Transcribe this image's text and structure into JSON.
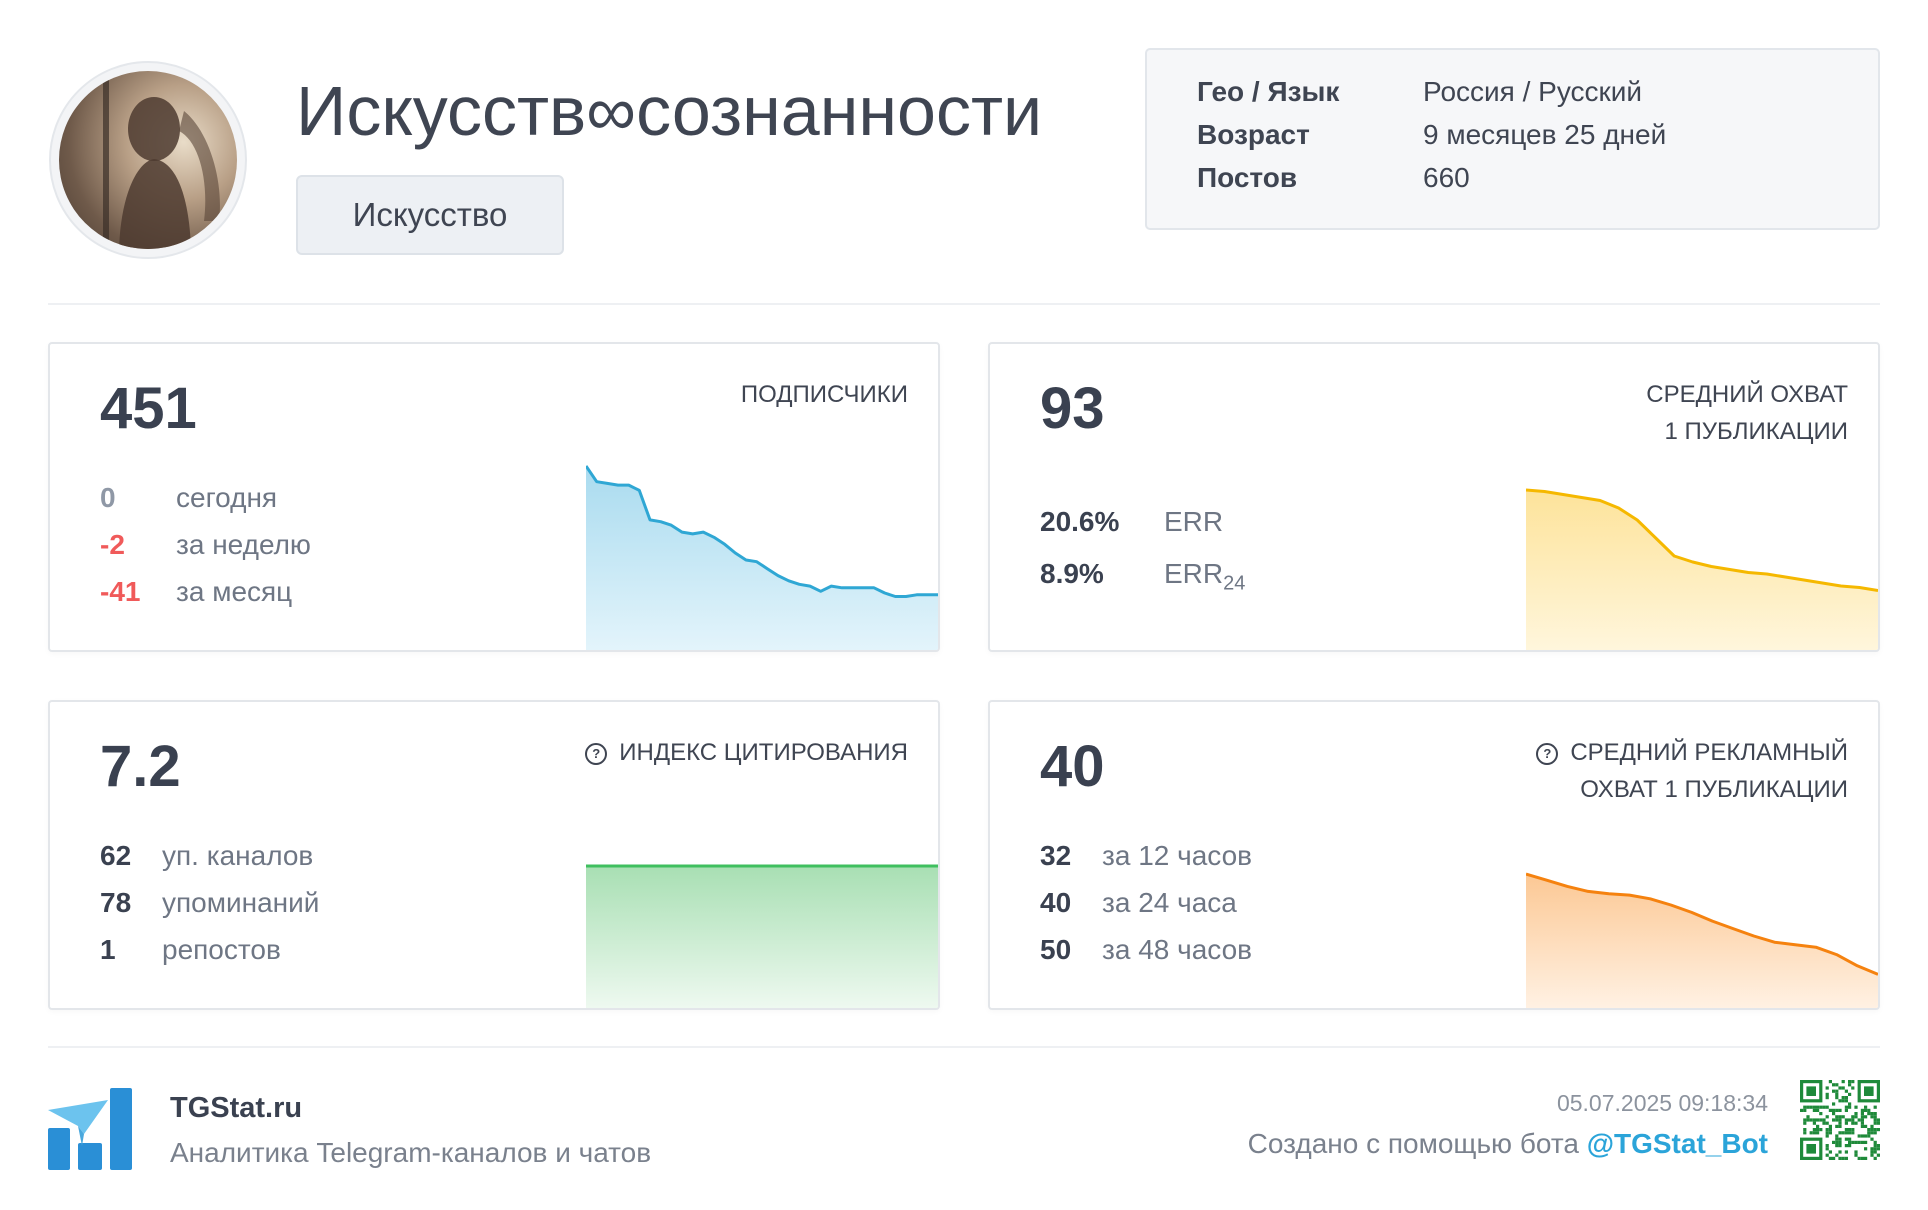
{
  "channel": {
    "title": "Искусств∞сознанности",
    "category": "Искусство"
  },
  "info": {
    "rows": [
      {
        "key": "Гео / Язык",
        "value": "Россия / Русский"
      },
      {
        "key": "Возраст",
        "value": "9 месяцев 25 дней"
      },
      {
        "key": "Постов",
        "value": "660"
      }
    ]
  },
  "subscribers": {
    "value": "451",
    "label": "ПОДПИСЧИКИ",
    "rows": [
      {
        "n": "0",
        "text": "сегодня"
      },
      {
        "n": "-2",
        "text": "за неделю"
      },
      {
        "n": "-41",
        "text": "за месяц"
      }
    ]
  },
  "reach": {
    "value": "93",
    "label_line1": "СРЕДНИЙ ОХВАТ",
    "label_line2": "1 ПУБЛИКАЦИИ",
    "err": {
      "n": "20.6%",
      "text": "ERR"
    },
    "err24": {
      "n": "8.9%",
      "text": "ERR",
      "sub": "24"
    }
  },
  "citation": {
    "value": "7.2",
    "label": "ИНДЕКС ЦИТИРОВАНИЯ",
    "rows": [
      {
        "n": "62",
        "text": "уп. каналов"
      },
      {
        "n": "78",
        "text": "упоминаний"
      },
      {
        "n": "1",
        "text": "репостов"
      }
    ]
  },
  "ad_reach": {
    "value": "40",
    "label_line1": "СРЕДНИЙ РЕКЛАМНЫЙ",
    "label_line2": "ОХВАТ 1 ПУБЛИКАЦИИ",
    "rows": [
      {
        "n": "32",
        "text": "за 12 часов"
      },
      {
        "n": "40",
        "text": "за 24 часа"
      },
      {
        "n": "50",
        "text": "за 48 часов"
      }
    ]
  },
  "footer": {
    "brand": "TGStat.ru",
    "tagline": "Аналитика Telegram-каналов и чатов",
    "timestamp": "05.07.2025 09:18:34",
    "made_with": "Создано с помощью бота",
    "bot": "@TGStat_Bot"
  },
  "colors": {
    "negative": "#f05a5a",
    "zero": "#8f98a6",
    "subscribers_line": "#2fa7d4",
    "reach_line": "#f5b800",
    "citation_line": "#3fbf5f",
    "ad_line": "#f5820f",
    "accent": "#2ba4d9"
  },
  "chart_data": [
    {
      "type": "area",
      "name": "subscribers_trend",
      "y": [
        100,
        91,
        90,
        89,
        89,
        86,
        69,
        68,
        66,
        62,
        61,
        62,
        59,
        55,
        50,
        46,
        45,
        41,
        37,
        34,
        32,
        31,
        28,
        31,
        30,
        30,
        30,
        30,
        27,
        25,
        25,
        26,
        26,
        26
      ]
    },
    {
      "type": "area",
      "name": "reach_trend",
      "y": [
        100,
        99,
        97,
        95,
        93,
        88,
        80,
        68,
        56,
        52,
        49,
        47,
        45,
        44,
        42,
        40,
        38,
        36,
        35,
        33
      ]
    },
    {
      "type": "area",
      "name": "citation_trend",
      "y": [
        100,
        100
      ]
    },
    {
      "type": "area",
      "name": "ad_reach_trend",
      "y": [
        100,
        95,
        90,
        86,
        84,
        83,
        80,
        75,
        69,
        62,
        56,
        50,
        45,
        43,
        41,
        35,
        26,
        19
      ]
    }
  ]
}
